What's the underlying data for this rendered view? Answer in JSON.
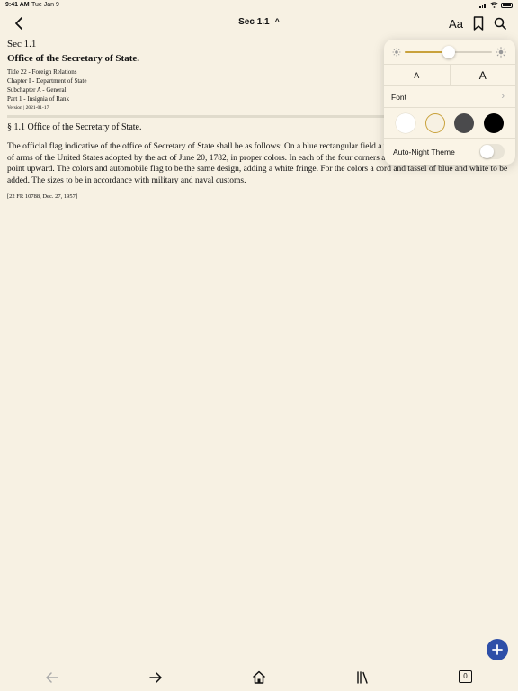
{
  "status_bar": {
    "time": "9:41 AM",
    "date": "Tue Jan 9"
  },
  "nav": {
    "title": "Sec 1.1",
    "font_button": "Aa"
  },
  "document": {
    "sec": "Sec 1.1",
    "heading": "Office of the Secretary of State.",
    "meta": [
      "Title 22 - Foreign Relations",
      "Chapter I - Department of State",
      "Subchapter A - General",
      "Part 1 - Insignia of Rank"
    ],
    "version": "Version | 2021-01-17",
    "section_title": "§ 1.1 Office of the Secretary of State.",
    "body": "The official flag indicative of the office of Secretary of State shall be as follows: On a blue rectangular field a white disk bearing the official coat of arms of the United States adopted by the act of June 20, 1782, in proper colors. In each of the four corners a white five-pointed star with one point upward. The colors and automobile flag to be the same design, adding a white fringe. For the colors a cord and tassel of blue and white to be added. The sizes to be in accordance with military and naval customs.",
    "citation": "[22 FR 10788, Dec. 27, 1957]"
  },
  "popover": {
    "brightness": 0.5,
    "font_small": "A",
    "font_large": "A",
    "font_label": "Font",
    "themes": [
      "#ffffff",
      "#f7f1e3",
      "#4a4a4c",
      "#000000"
    ],
    "selected_theme": 1,
    "night_label": "Auto-Night Theme",
    "night_on": false
  },
  "toolbar": {
    "tabs_count": "0"
  },
  "colors": {
    "accent": "#c9a23c",
    "fab": "#2e4fa8",
    "background": "#f7f1e3"
  }
}
